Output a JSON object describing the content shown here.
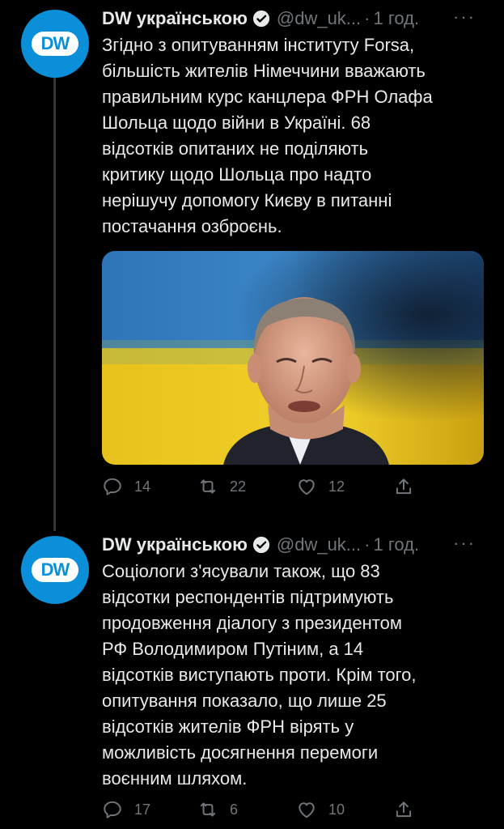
{
  "colors": {
    "background": "#000000",
    "text": "#e7e9ea",
    "secondary": "#71767b",
    "accent": "#1d9bf0",
    "avatar": "#0c8fd9"
  },
  "tweets": [
    {
      "author_name": "DW українською",
      "handle": "@dw_uk...",
      "separator": "·",
      "time": "1 год.",
      "more": "···",
      "avatar_text": "DW",
      "text": "Згідно з опитуванням інституту Forsa,\nбільшість жителів Німеччини вважають\nправильним курс канцлера ФРН Олафа\nШольца щодо війни в Україні. 68\nвідсотків опитаних не поділяють\nкритику щодо Шольца про надто\nнерішучу допомогу Києву в питанні\nпостачання озброєнь.",
      "media": "photo of a man in front of the Ukrainian flag",
      "replies": "14",
      "retweets": "22",
      "likes": "12",
      "icons": [
        "reply-icon",
        "retweet-icon",
        "like-icon",
        "share-icon"
      ]
    },
    {
      "author_name": "DW українською",
      "handle": "@dw_uk...",
      "separator": "·",
      "time": "1 год.",
      "more": "···",
      "avatar_text": "DW",
      "text": "Соціологи з'ясували також, що 83\nвідсотки респондентів підтримують\nпродовження діалогу з президентом\nРФ Володимиром Путіним, а 14\nвідсотків виступають проти. Крім того,\nопитування показало, що лише 25\nвідсотків жителів ФРН вірять у\nможливість досягнення перемоги\nвоєнним шляхом.",
      "replies": "17",
      "retweets": "6",
      "likes": "10",
      "icons": [
        "reply-icon",
        "retweet-icon",
        "like-icon",
        "share-icon"
      ]
    }
  ]
}
